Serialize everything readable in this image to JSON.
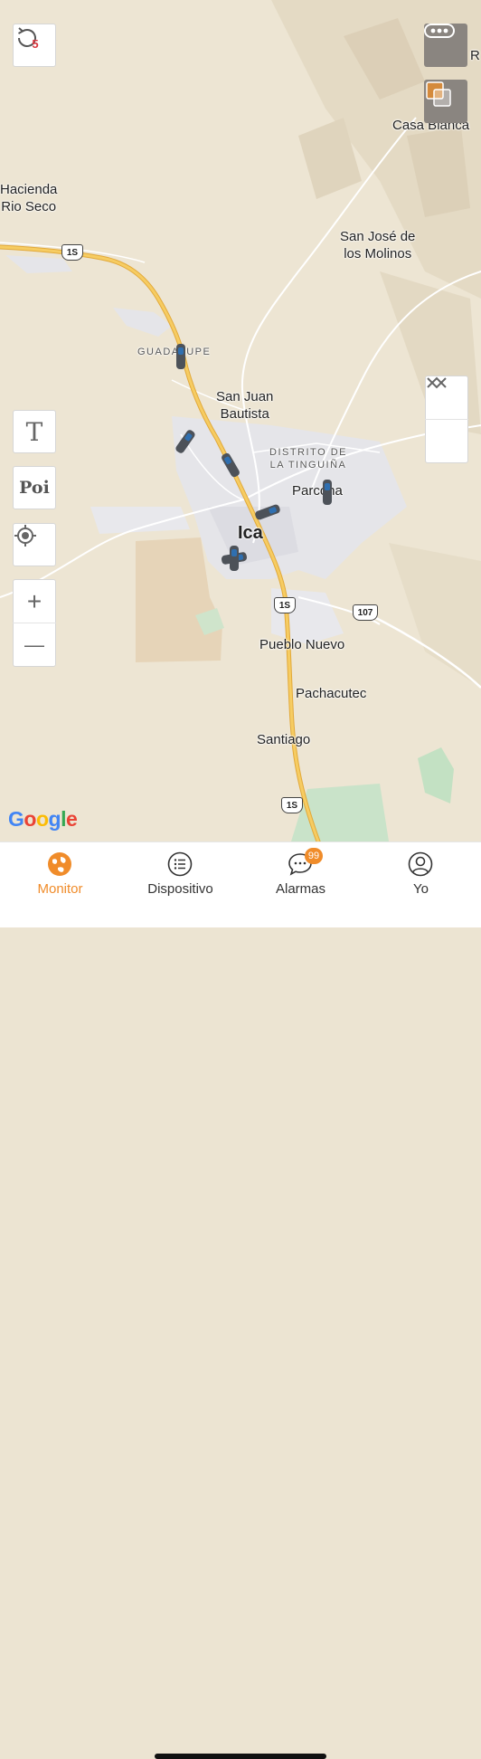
{
  "map": {
    "places": {
      "casa_blanca": "Casa Blanca",
      "r_edge": "R",
      "hacienda": "Hacienda\nRio Seco",
      "san_jose": "San José de\nlos Molinos",
      "guadalupe": "GUADALUPE",
      "san_juan": "San Juan\nBautista",
      "tinguina": "DISTRITO DE\nLA TINGUIÑA",
      "parcona": "Parcona",
      "ica": "Ica",
      "pueblo_nuevo": "Pueblo Nuevo",
      "pachacutec": "Pachacutec",
      "santiago": "Santiago"
    },
    "shields": {
      "s1": "1S",
      "s2": "1S",
      "s3": "1S",
      "s4": "107"
    },
    "attribution": "Google"
  },
  "controls": {
    "refresh_count": "5",
    "text_tool": "T",
    "poi_tool": "Poi",
    "zoom_in": "+",
    "zoom_out": "—"
  },
  "tabs": [
    {
      "label": "Monitor",
      "icon": "globe-icon"
    },
    {
      "label": "Dispositivo",
      "icon": "list-icon"
    },
    {
      "label": "Alarmas",
      "icon": "chat-icon",
      "badge": "99"
    },
    {
      "label": "Yo",
      "icon": "user-icon"
    }
  ],
  "colors": {
    "accent": "#f08c2a",
    "highway": "#f3c04f",
    "urban": "#e6e6ea",
    "map_bg": "#ede5d3"
  }
}
